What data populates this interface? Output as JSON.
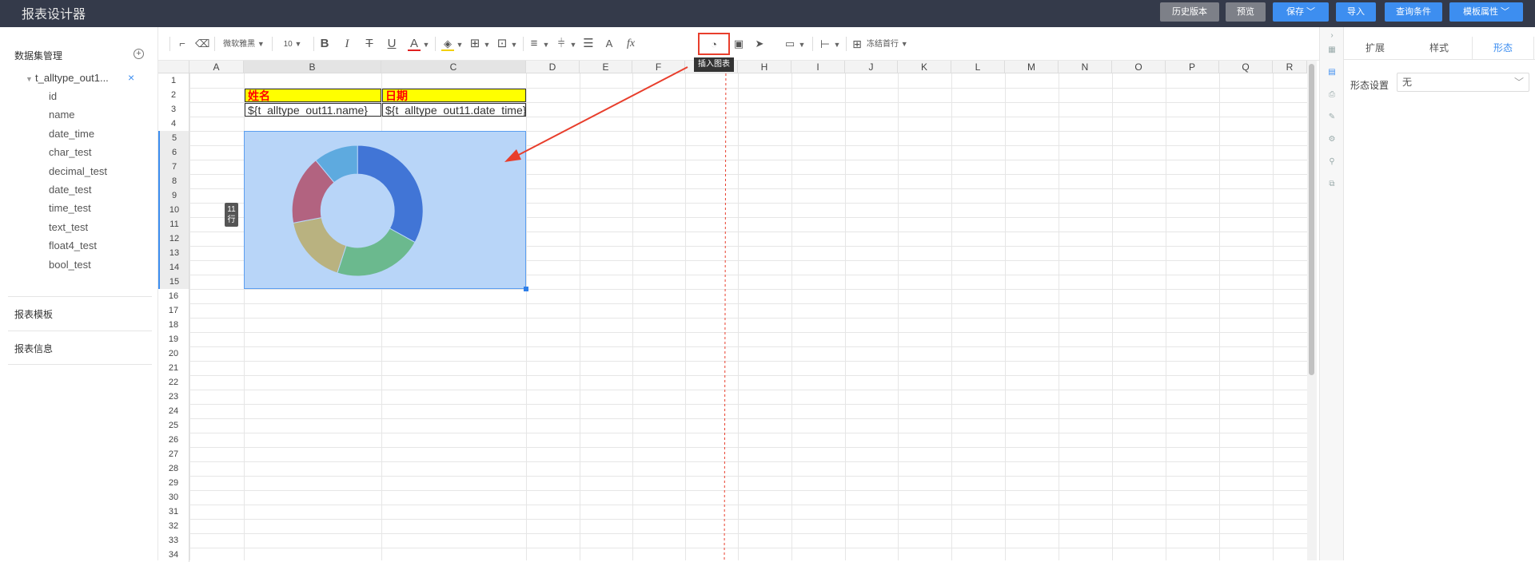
{
  "app": {
    "title": "报表设计器"
  },
  "header_buttons": {
    "history": "历史版本",
    "preview": "预览",
    "save": "保存",
    "import": "导入",
    "query": "查询条件",
    "template_props": "模板属性"
  },
  "left_panel": {
    "dataset_title": "数据集管理",
    "dataset_name": "t_alltype_out1...",
    "fields": [
      "id",
      "name",
      "date_time",
      "char_test",
      "decimal_test",
      "date_test",
      "time_test",
      "text_test",
      "float4_test",
      "bool_test"
    ],
    "report_template": "报表模板",
    "report_info": "报表信息"
  },
  "toolbar": {
    "font_name": "微软雅黑",
    "font_size": "10",
    "freeze": "冻结首行",
    "fx": "fx",
    "tooltip": "插入图表",
    "icons": [
      "format-painter-icon",
      "eraser-icon",
      "bold-icon",
      "italic-icon",
      "strikethrough-icon",
      "underline-icon",
      "font-color-icon",
      "fill-color-icon",
      "border-icon",
      "merge-cells-icon",
      "align-horizontal-icon",
      "align-vertical-icon",
      "wrap-text-icon",
      "text-style-icon",
      "function-icon",
      "insert-chart-icon",
      "insert-image-icon",
      "insert-qrcode-icon",
      "comment-icon",
      "column-width-icon",
      "freeze-icon"
    ]
  },
  "sheet": {
    "columns": [
      "A",
      "B",
      "C",
      "D",
      "E",
      "F",
      "G",
      "H",
      "I",
      "J",
      "K",
      "L",
      "M",
      "N",
      "O",
      "P",
      "Q",
      "R"
    ],
    "rows": [
      1,
      2,
      3,
      4,
      5,
      6,
      7,
      8,
      9,
      10,
      11,
      12,
      13,
      14,
      15,
      16,
      17,
      18,
      19,
      20,
      21,
      22,
      23,
      24,
      25,
      26,
      27,
      28,
      29,
      30,
      31,
      32,
      33,
      34
    ],
    "cells": {
      "B2": "姓名",
      "C2": "日期",
      "B3": "${t_alltype_out11.name}",
      "C3": "${t_alltype_out11.date_time}"
    },
    "merge_badge": "11\n行",
    "header_fill": "#ffff00",
    "header_text_color": "#ff0000"
  },
  "chart_data": {
    "type": "pie",
    "style": "doughnut",
    "slices": [
      {
        "value": 33,
        "color": "#4175d6"
      },
      {
        "value": 22,
        "color": "#6bb98e"
      },
      {
        "value": 17,
        "color": "#b9b280"
      },
      {
        "value": 17,
        "color": "#b26380"
      },
      {
        "value": 11,
        "color": "#5eaadf"
      }
    ],
    "background": "#b8d5f8"
  },
  "right_panel": {
    "tabs": [
      "扩展",
      "样式",
      "形态"
    ],
    "active_tab": "形态",
    "form_label": "形态设置",
    "form_value": "无"
  },
  "colors": {
    "accent": "#3d8ef0",
    "annotation_red": "#e83e2c",
    "topbar": "#343a4a"
  }
}
